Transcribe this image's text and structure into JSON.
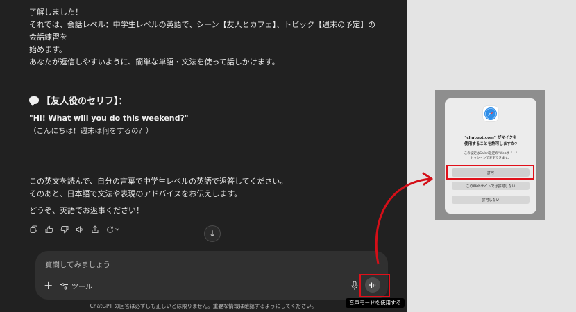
{
  "chat": {
    "intro_lines": [
      "了解しました！",
      "それでは、会話レベル：中学生レベルの英語で、シーン【友人とカフェ】、トピック【週末の予定】の会話練習を",
      "始めます。",
      "あなたが返信しやすいように、簡単な単語・文法を使って話しかけます。"
    ],
    "quote_heading": "【友人役のセリフ】：",
    "quote_en": "\"Hi! What will you do this weekend?\"",
    "quote_ja": "（こんにちは！週末は何をするの？）",
    "closing_lines": [
      "この英文を読んで、自分の言葉で中学生レベルの英語で返答してください。",
      "そのあと、日本語で文法や表現のアドバイスをお伝えします。",
      "どうぞ、英語でお返事ください！"
    ],
    "actions": [
      "copy-icon",
      "thumbs-up-icon",
      "thumbs-down-icon",
      "speaker-icon",
      "share-icon",
      "regenerate-icon"
    ]
  },
  "composer": {
    "placeholder": "質問してみましょう",
    "tools_label": "ツール"
  },
  "tooltip": "音声モードを使用する",
  "disclaimer": "ChatGPT の回答は必ずしも正しいとは限りません。重要な情報は確認するようにしてください。",
  "dialog": {
    "title_lines": [
      "\"chatgpt.com\" がマイクを",
      "使用することを許可しますか?"
    ],
    "note_lines": [
      "この設定はSafari設定の\"Webサイト\"",
      "セクションで変更できます。"
    ],
    "allow_label": "許可",
    "never_label": "このWebサイトでは許可しない",
    "deny_label": "許可しない"
  },
  "colors": {
    "highlight": "#e0101a",
    "chat_bg": "#212121",
    "composer_bg": "#303030"
  }
}
